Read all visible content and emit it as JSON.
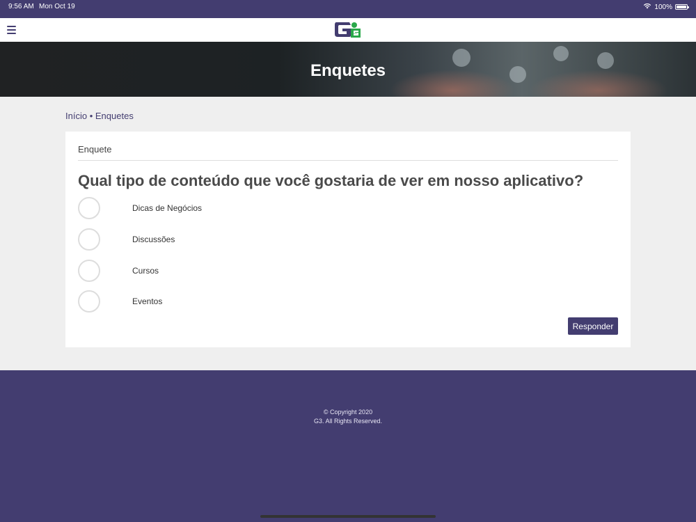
{
  "status_bar": {
    "time": "9:56 AM",
    "date": "Mon Oct 19",
    "battery": "100%",
    "icons": [
      "wifi-icon",
      "battery-icon"
    ]
  },
  "navbar": {
    "menu_icon": "hamburger-menu-icon",
    "logo_text": "G3",
    "logo_colors": {
      "g": "#433d70",
      "three": "#2aa84a"
    }
  },
  "hero": {
    "title": "Enquetes"
  },
  "breadcrumb": {
    "home": "Início",
    "separator": "•",
    "current": "Enquetes"
  },
  "poll": {
    "header": "Enquete",
    "question": "Qual tipo de conteúdo que você gostaria de ver em nosso aplicativo?",
    "options": [
      {
        "label": "Dicas de Negócios",
        "selected": false
      },
      {
        "label": "Discussões",
        "selected": false
      },
      {
        "label": "Cursos",
        "selected": false
      },
      {
        "label": "Eventos",
        "selected": false
      }
    ],
    "submit_label": "Responder"
  },
  "footer": {
    "copyright": "© Copyright 2020",
    "rights": "G3. All Rights Reserved."
  },
  "colors": {
    "brand": "#433d70",
    "page_bg": "#efefef",
    "card_bg": "#ffffff"
  }
}
